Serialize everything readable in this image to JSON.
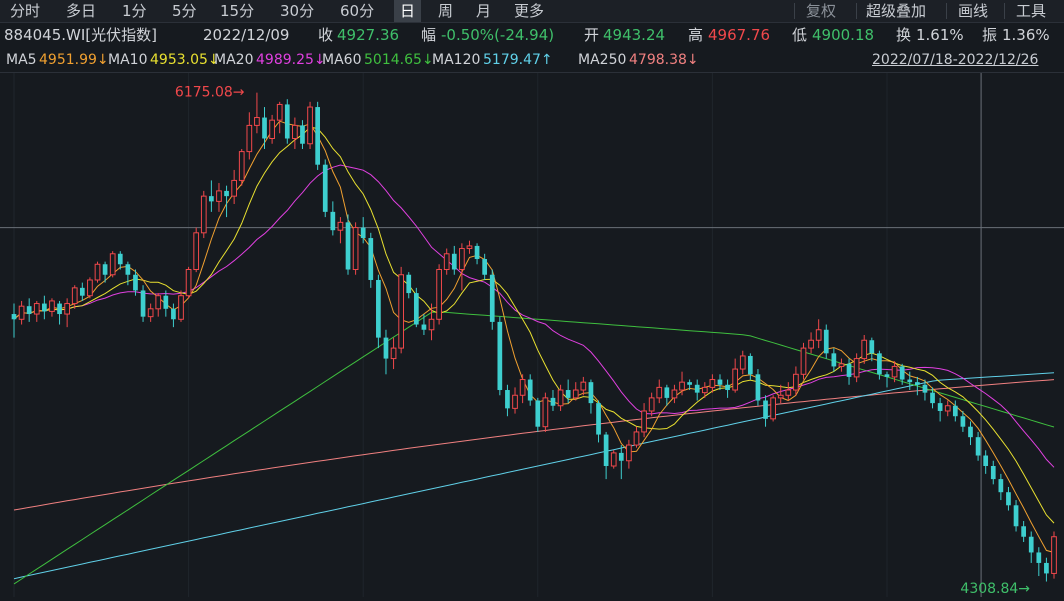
{
  "toolbar": {
    "periods": [
      "分时",
      "多日",
      "1分",
      "5分",
      "15分",
      "30分",
      "60分",
      "日",
      "周",
      "月",
      "更多"
    ],
    "active": "日",
    "right": [
      "复权",
      "超级叠加",
      "画线",
      "工具"
    ]
  },
  "info": {
    "code": "884045.WI[光伏指数]",
    "date": "2022/12/09",
    "close_label": "收",
    "close": "4927.36",
    "chg_label": "幅",
    "chg": "-0.50%(-24.94)",
    "open_label": "开",
    "open": "4943.24",
    "high_label": "高",
    "high": "4967.76",
    "low_label": "低",
    "low": "4900.18",
    "turnover_label": "换",
    "turnover": "1.61%",
    "amp_label": "振",
    "amp": "1.36%"
  },
  "ma": [
    {
      "name": "MA5",
      "value": "4951.99",
      "arrow": "↓",
      "color": "#f0a030"
    },
    {
      "name": "MA10",
      "value": "4953.05",
      "arrow": "↓",
      "color": "#e8e030"
    },
    {
      "name": "MA20",
      "value": "4989.25",
      "arrow": "↓",
      "color": "#e040e0"
    },
    {
      "name": "MA60",
      "value": "5014.65",
      "arrow": "↓",
      "color": "#3fbf3f"
    },
    {
      "name": "MA120",
      "value": "5179.47",
      "arrow": "↑",
      "color": "#60d0e8"
    },
    {
      "name": "MA250",
      "value": "4798.38",
      "arrow": "↓",
      "color": "#f08080"
    }
  ],
  "range": "2022/07/18-2022/12/26",
  "chart_data": {
    "type": "candlestick",
    "ylim": [
      4250,
      6250
    ],
    "high_mark": "6175.08",
    "low_mark": "4308.84",
    "hline": 5660,
    "up_color": "#f0484b",
    "down_color": "#3ecfcf",
    "candles": [
      [
        5330,
        5310,
        5370,
        5240
      ],
      [
        5310,
        5360,
        5380,
        5290
      ],
      [
        5360,
        5330,
        5390,
        5300
      ],
      [
        5330,
        5370,
        5380,
        5300
      ],
      [
        5370,
        5340,
        5400,
        5310
      ],
      [
        5340,
        5380,
        5390,
        5320
      ],
      [
        5370,
        5330,
        5380,
        5290
      ],
      [
        5330,
        5370,
        5390,
        5280
      ],
      [
        5370,
        5430,
        5440,
        5350
      ],
      [
        5430,
        5400,
        5450,
        5380
      ],
      [
        5400,
        5460,
        5470,
        5390
      ],
      [
        5460,
        5520,
        5530,
        5450
      ],
      [
        5520,
        5480,
        5530,
        5450
      ],
      [
        5480,
        5560,
        5570,
        5470
      ],
      [
        5560,
        5520,
        5570,
        5500
      ],
      [
        5520,
        5480,
        5530,
        5440
      ],
      [
        5480,
        5420,
        5500,
        5400
      ],
      [
        5420,
        5320,
        5440,
        5300
      ],
      [
        5320,
        5350,
        5370,
        5300
      ],
      [
        5350,
        5400,
        5410,
        5320
      ],
      [
        5400,
        5350,
        5420,
        5320
      ],
      [
        5350,
        5310,
        5370,
        5280
      ],
      [
        5310,
        5400,
        5420,
        5300
      ],
      [
        5400,
        5500,
        5510,
        5390
      ],
      [
        5500,
        5640,
        5660,
        5490
      ],
      [
        5640,
        5780,
        5800,
        5620
      ],
      [
        5780,
        5760,
        5840,
        5720
      ],
      [
        5760,
        5800,
        5830,
        5720
      ],
      [
        5800,
        5780,
        5820,
        5700
      ],
      [
        5780,
        5840,
        5880,
        5750
      ],
      [
        5840,
        5950,
        5960,
        5820
      ],
      [
        5950,
        6050,
        6100,
        5920
      ],
      [
        6050,
        6080,
        6175,
        6020
      ],
      [
        6080,
        6000,
        6120,
        5960
      ],
      [
        6000,
        6070,
        6090,
        5980
      ],
      [
        6070,
        6130,
        6140,
        6020
      ],
      [
        6130,
        6000,
        6150,
        5980
      ],
      [
        6000,
        6050,
        6080,
        5960
      ],
      [
        6050,
        5980,
        6070,
        5960
      ],
      [
        5980,
        6120,
        6140,
        5960
      ],
      [
        6120,
        5900,
        6140,
        5880
      ],
      [
        5900,
        5720,
        5920,
        5700
      ],
      [
        5720,
        5650,
        5760,
        5630
      ],
      [
        5650,
        5680,
        5700,
        5600
      ],
      [
        5680,
        5500,
        5710,
        5480
      ],
      [
        5500,
        5660,
        5680,
        5480
      ],
      [
        5660,
        5620,
        5700,
        5600
      ],
      [
        5620,
        5460,
        5640,
        5430
      ],
      [
        5460,
        5240,
        5480,
        5200
      ],
      [
        5240,
        5160,
        5270,
        5100
      ],
      [
        5160,
        5200,
        5240,
        5120
      ],
      [
        5200,
        5480,
        5510,
        5180
      ],
      [
        5480,
        5410,
        5490,
        5390
      ],
      [
        5410,
        5290,
        5430,
        5280
      ],
      [
        5290,
        5270,
        5330,
        5250
      ],
      [
        5270,
        5310,
        5370,
        5230
      ],
      [
        5310,
        5500,
        5520,
        5290
      ],
      [
        5500,
        5560,
        5580,
        5480
      ],
      [
        5560,
        5500,
        5590,
        5480
      ],
      [
        5500,
        5580,
        5600,
        5420
      ],
      [
        5580,
        5590,
        5610,
        5560
      ],
      [
        5590,
        5540,
        5600,
        5520
      ],
      [
        5540,
        5480,
        5560,
        5460
      ],
      [
        5480,
        5300,
        5500,
        5270
      ],
      [
        5300,
        5040,
        5320,
        5020
      ],
      [
        5040,
        4970,
        5060,
        4940
      ],
      [
        4970,
        5020,
        5050,
        4950
      ],
      [
        5020,
        5080,
        5100,
        4990
      ],
      [
        5080,
        5000,
        5100,
        4980
      ],
      [
        5000,
        4900,
        5010,
        4880
      ],
      [
        4900,
        5010,
        5030,
        4880
      ],
      [
        5010,
        4980,
        5040,
        4960
      ],
      [
        4980,
        5040,
        5060,
        4960
      ],
      [
        5040,
        5010,
        5080,
        4990
      ],
      [
        5010,
        5040,
        5070,
        5000
      ],
      [
        5040,
        5070,
        5090,
        5020
      ],
      [
        5070,
        4990,
        5080,
        4950
      ],
      [
        4990,
        4870,
        5000,
        4840
      ],
      [
        4870,
        4750,
        4880,
        4700
      ],
      [
        4750,
        4800,
        4810,
        4740
      ],
      [
        4800,
        4770,
        4830,
        4700
      ],
      [
        4770,
        4830,
        4850,
        4740
      ],
      [
        4830,
        4880,
        4900,
        4820
      ],
      [
        4880,
        4960,
        4990,
        4860
      ],
      [
        4960,
        5010,
        5030,
        4940
      ],
      [
        5010,
        5050,
        5080,
        4990
      ],
      [
        5050,
        5010,
        5060,
        4980
      ],
      [
        5010,
        5040,
        5060,
        4990
      ],
      [
        5040,
        5070,
        5110,
        5020
      ],
      [
        5070,
        5060,
        5080,
        5040
      ],
      [
        5060,
        5030,
        5080,
        5000
      ],
      [
        5030,
        5050,
        5070,
        5010
      ],
      [
        5050,
        5080,
        5100,
        5030
      ],
      [
        5080,
        5060,
        5100,
        5040
      ],
      [
        5060,
        5040,
        5080,
        5010
      ],
      [
        5040,
        5120,
        5160,
        5030
      ],
      [
        5120,
        5170,
        5190,
        5100
      ],
      [
        5170,
        5100,
        5180,
        5080
      ],
      [
        5100,
        5000,
        5120,
        4980
      ],
      [
        5000,
        4930,
        5020,
        4900
      ],
      [
        4930,
        5010,
        5020,
        4920
      ],
      [
        5010,
        5020,
        5060,
        4990
      ],
      [
        5020,
        5040,
        5070,
        5000
      ],
      [
        5040,
        5100,
        5130,
        5020
      ],
      [
        5100,
        5200,
        5220,
        5080
      ],
      [
        5200,
        5230,
        5260,
        5180
      ],
      [
        5230,
        5270,
        5310,
        5200
      ],
      [
        5270,
        5180,
        5290,
        5160
      ],
      [
        5180,
        5130,
        5200,
        5110
      ],
      [
        5130,
        5140,
        5160,
        5110
      ],
      [
        5140,
        5090,
        5160,
        5060
      ],
      [
        5090,
        5160,
        5180,
        5070
      ],
      [
        5160,
        5230,
        5250,
        5140
      ],
      [
        5230,
        5180,
        5240,
        5150
      ],
      [
        5180,
        5100,
        5190,
        5080
      ],
      [
        5100,
        5090,
        5110,
        5050
      ],
      [
        5090,
        5130,
        5150,
        5070
      ],
      [
        5130,
        5080,
        5140,
        5060
      ],
      [
        5080,
        5070,
        5110,
        5040
      ],
      [
        5070,
        5060,
        5090,
        5020
      ],
      [
        5060,
        5030,
        5080,
        5000
      ],
      [
        5030,
        4990,
        5050,
        4970
      ],
      [
        4990,
        4960,
        5010,
        4920
      ],
      [
        4960,
        4980,
        5000,
        4940
      ],
      [
        4980,
        4940,
        5000,
        4920
      ],
      [
        4940,
        4900,
        4960,
        4880
      ],
      [
        4900,
        4860,
        4920,
        4830
      ],
      [
        4860,
        4790,
        4880,
        4770
      ],
      [
        4790,
        4750,
        4810,
        4720
      ],
      [
        4750,
        4700,
        4770,
        4680
      ],
      [
        4700,
        4650,
        4720,
        4620
      ],
      [
        4650,
        4600,
        4670,
        4580
      ],
      [
        4600,
        4520,
        4620,
        4500
      ],
      [
        4520,
        4480,
        4540,
        4460
      ],
      [
        4480,
        4420,
        4500,
        4380
      ],
      [
        4420,
        4380,
        4440,
        4330
      ],
      [
        4380,
        4340,
        4400,
        4309
      ],
      [
        4340,
        4480,
        4500,
        4320
      ]
    ]
  }
}
